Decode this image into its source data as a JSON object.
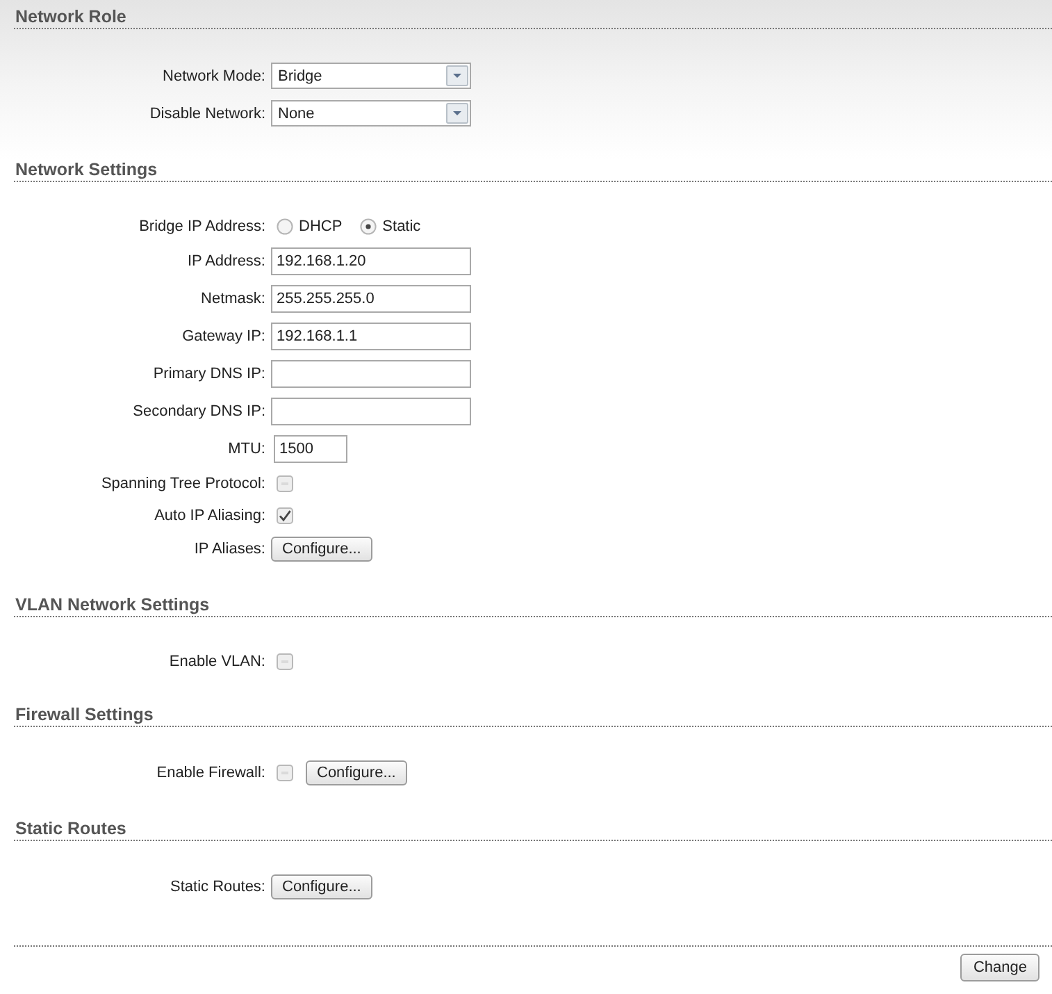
{
  "sections": [
    {
      "title": "Network Role",
      "rows": [
        {
          "label": "Network Mode:",
          "controls": [
            {
              "kind": "select",
              "value": "Bridge"
            }
          ]
        },
        {
          "label": "Disable Network:",
          "controls": [
            {
              "kind": "select",
              "value": "None"
            }
          ]
        }
      ]
    },
    {
      "title": "Network Settings",
      "rows": [
        {
          "label": "Bridge IP Address:",
          "controls": [
            {
              "kind": "radio",
              "label": "DHCP",
              "selected": false
            },
            {
              "kind": "radio",
              "label": "Static",
              "selected": true
            }
          ]
        },
        {
          "label": "IP Address:",
          "controls": [
            {
              "kind": "text",
              "value": "192.168.1.20"
            }
          ]
        },
        {
          "label": "Netmask:",
          "controls": [
            {
              "kind": "text",
              "value": "255.255.255.0"
            }
          ]
        },
        {
          "label": "Gateway IP:",
          "controls": [
            {
              "kind": "text",
              "value": "192.168.1.1"
            }
          ]
        },
        {
          "label": "Primary DNS IP:",
          "controls": [
            {
              "kind": "text"
            }
          ]
        },
        {
          "label": "Secondary DNS IP:",
          "controls": [
            {
              "kind": "text"
            }
          ]
        },
        {
          "label": "MTU:",
          "controls": [
            {
              "kind": "short_text",
              "value": "1500"
            }
          ]
        },
        {
          "label": "Spanning Tree Protocol:",
          "controls": [
            {
              "kind": "checkbox",
              "checked": false
            }
          ]
        },
        {
          "label": "Auto IP Aliasing:",
          "controls": [
            {
              "kind": "checkbox",
              "checked": true
            }
          ]
        },
        {
          "label": "IP Aliases:",
          "controls": [
            {
              "kind": "button",
              "label": "Configure..."
            }
          ]
        }
      ]
    },
    {
      "title": "VLAN Network Settings",
      "rows": [
        {
          "label": "Enable VLAN:",
          "controls": [
            {
              "kind": "checkbox",
              "checked": false
            }
          ]
        }
      ]
    },
    {
      "title": "Firewall Settings",
      "rows": [
        {
          "label": "Enable Firewall:",
          "controls": [
            {
              "kind": "checkbox",
              "checked": false
            },
            {
              "kind": "button",
              "label": "Configure..."
            }
          ]
        }
      ]
    },
    {
      "title": "Static Routes",
      "rows": [
        {
          "label": "Static Routes:",
          "controls": [
            {
              "kind": "button",
              "label": "Configure..."
            }
          ]
        }
      ]
    }
  ],
  "footer": {
    "button": "Change"
  }
}
